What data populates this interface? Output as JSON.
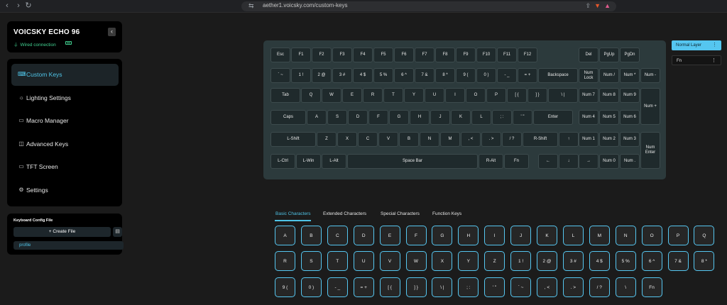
{
  "browser": {
    "url": "aether1.voicsky.com/custom-keys",
    "back_icon": "‹",
    "forward_icon": "›",
    "reload_icon": "↻"
  },
  "device": {
    "name": "VOICSKY ECHO 96",
    "connection": "Wired connection",
    "collapse_icon": "‹"
  },
  "menu": [
    {
      "label": "Custom Keys",
      "icon": "keyboard-icon",
      "glyph": "⌨",
      "active": true
    },
    {
      "label": "Lighting Settings",
      "icon": "bulb-icon",
      "glyph": "☼",
      "active": false
    },
    {
      "label": "Macro Manager",
      "icon": "macro-icon",
      "glyph": "▭",
      "active": false
    },
    {
      "label": "Advanced Keys",
      "icon": "advanced-keys-icon",
      "glyph": "◫",
      "active": false
    },
    {
      "label": "TFT Screen",
      "icon": "monitor-icon",
      "glyph": "▭",
      "active": false
    },
    {
      "label": "Settings",
      "icon": "gear-icon",
      "glyph": "⚙",
      "active": false
    }
  ],
  "config": {
    "header": "Keyboard Config File",
    "create_label": "+ Create File",
    "profile": "profile"
  },
  "keyboard": {
    "rows": [
      [
        "Esc",
        "F1",
        "F2",
        "F3",
        "F4",
        "F5",
        "F6",
        "F7",
        "F8",
        "F9",
        "F10",
        "F11",
        "F12",
        "Del",
        "PgUp",
        "PgDn"
      ],
      [
        "` ~",
        "1 !",
        "2 @",
        "3 #",
        "4 $",
        "5 %",
        "6 ^",
        "7 &",
        "8 *",
        "9 (",
        "0 )",
        "- _",
        "= +",
        "Backspace",
        "Num Lock",
        "Num /",
        "Num *",
        "Num -"
      ],
      [
        "Tab",
        "Q",
        "W",
        "E",
        "R",
        "T",
        "Y",
        "U",
        "I",
        "O",
        "P",
        "[ {",
        "] }",
        "\\ |",
        "Num 7",
        "Num 8",
        "Num 9",
        "Num +"
      ],
      [
        "Caps",
        "A",
        "S",
        "D",
        "F",
        "G",
        "H",
        "J",
        "K",
        "L",
        "; :",
        "' \"",
        "Enter",
        "Num 4",
        "Num 5",
        "Num 6"
      ],
      [
        "L-Shift",
        "Z",
        "X",
        "C",
        "V",
        "B",
        "N",
        "M",
        ", <",
        ". >",
        "/ ?",
        "R-Shift",
        "↑",
        "Num 1",
        "Num 2",
        "Num 3",
        "Num Enter"
      ],
      [
        "L-Ctrl",
        "L-Win",
        "L-Alt",
        "Space Bar",
        "R-Alt",
        "Fn",
        "←",
        "↓",
        "→",
        "Num 0",
        "Num ."
      ]
    ]
  },
  "layers": [
    {
      "label": "Normal Layer",
      "active": true
    },
    {
      "label": "Fn",
      "active": false
    }
  ],
  "tabs": [
    "Basic Characters",
    "Extended Characters",
    "Special Characters",
    "Function Keys"
  ],
  "characters": [
    [
      "A",
      "B",
      "C",
      "D",
      "E",
      "F",
      "G",
      "H",
      "I",
      "J",
      "K",
      "L",
      "M",
      "N",
      "O",
      "P",
      "Q"
    ],
    [
      "R",
      "S",
      "T",
      "U",
      "V",
      "W",
      "X",
      "Y",
      "Z",
      "1 !",
      "2 @",
      "3 #",
      "4 $",
      "5 %",
      "6 ^",
      "7 &",
      "8 *"
    ],
    [
      "9 (",
      "0 )",
      "- _",
      "= +",
      "[ {",
      "] }",
      "\\ |",
      "; :",
      "' \"",
      "` ~",
      ", <",
      ". >",
      "/ ?",
      "\\",
      "Fn"
    ]
  ],
  "colors": {
    "accent": "#4fc3e6",
    "connected": "#42d392",
    "keyboard_bg": "#2c3a3c"
  }
}
